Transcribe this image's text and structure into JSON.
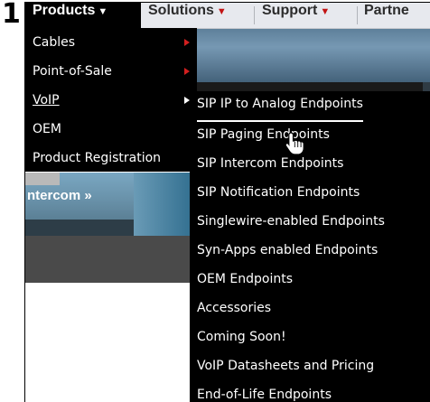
{
  "step_number": "1",
  "nav": {
    "items": [
      {
        "label": "Products",
        "caret": "▼"
      },
      {
        "label": "Solutions",
        "caret": "▼"
      },
      {
        "label": "Support",
        "caret": "▼"
      },
      {
        "label": "Partne",
        "caret": ""
      }
    ]
  },
  "background": {
    "banner_text": "ntercom »"
  },
  "products_menu": {
    "items": [
      {
        "label": "Cables"
      },
      {
        "label": "Point-of-Sale"
      },
      {
        "label": "VoIP"
      },
      {
        "label": "OEM"
      },
      {
        "label": "Product Registration"
      }
    ]
  },
  "voip_submenu": {
    "items": [
      {
        "label": "SIP IP to Analog Endpoints"
      },
      {
        "label": "SIP Paging Endpoints"
      },
      {
        "label": "SIP Intercom Endpoints"
      },
      {
        "label": "SIP Notification Endpoints"
      },
      {
        "label": "Singlewire-enabled Endpoints"
      },
      {
        "label": "Syn-Apps enabled Endpoints"
      },
      {
        "label": "OEM Endpoints"
      },
      {
        "label": "Accessories"
      },
      {
        "label": "Coming Soon!"
      },
      {
        "label": "VoIP Datasheets and Pricing"
      },
      {
        "label": "End-of-Life Endpoints"
      }
    ]
  },
  "colors": {
    "menu_background": "#000000",
    "caret_red": "#c21313",
    "navbar_background": "#e7e9ee"
  },
  "icons": [
    "hand-pointer-cursor",
    "submenu-arrow"
  ]
}
